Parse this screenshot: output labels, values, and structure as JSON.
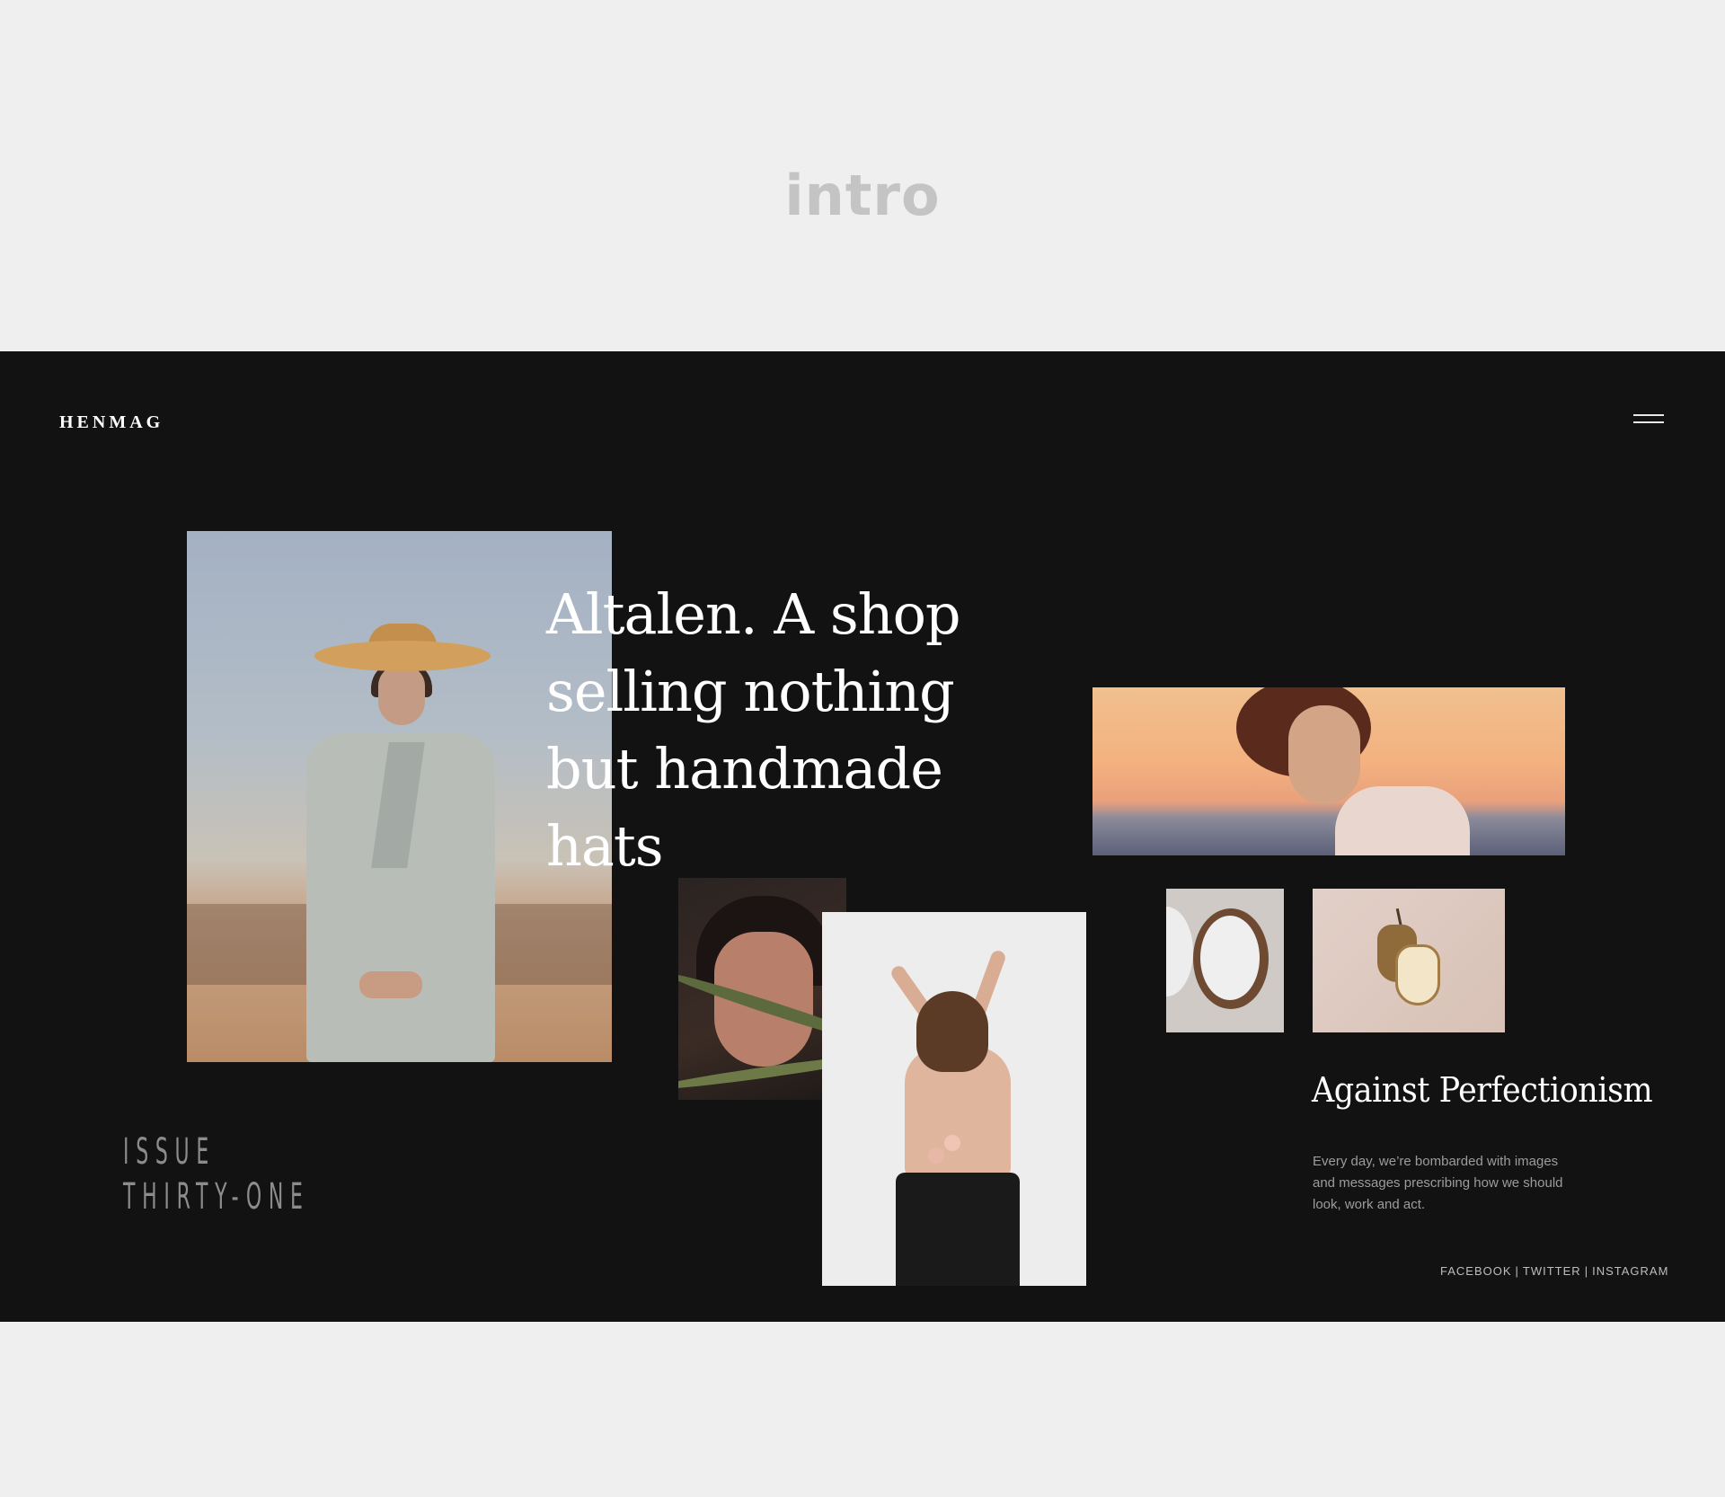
{
  "page": {
    "label": "intro"
  },
  "header": {
    "logo": "HENMAG",
    "menu_icon": "hamburger-menu-icon"
  },
  "hero": {
    "headline": "Altalen. A shop selling nothing but handmade hats",
    "issue_line1": "ISSUE",
    "issue_line2": "THIRTY-ONE"
  },
  "article": {
    "title": "Against Perfectionism",
    "body": "Every day, we’re bombarded with images and messages prescribing how we should look, work and act."
  },
  "social": {
    "facebook": "FACEBOOK",
    "twitter": "TWITTER",
    "instagram": "INSTAGRAM",
    "separator": "|"
  },
  "colors": {
    "page_bg": "#efefef",
    "hero_bg": "#121213",
    "text_primary": "#ffffff",
    "text_muted": "#9c9c9c"
  }
}
